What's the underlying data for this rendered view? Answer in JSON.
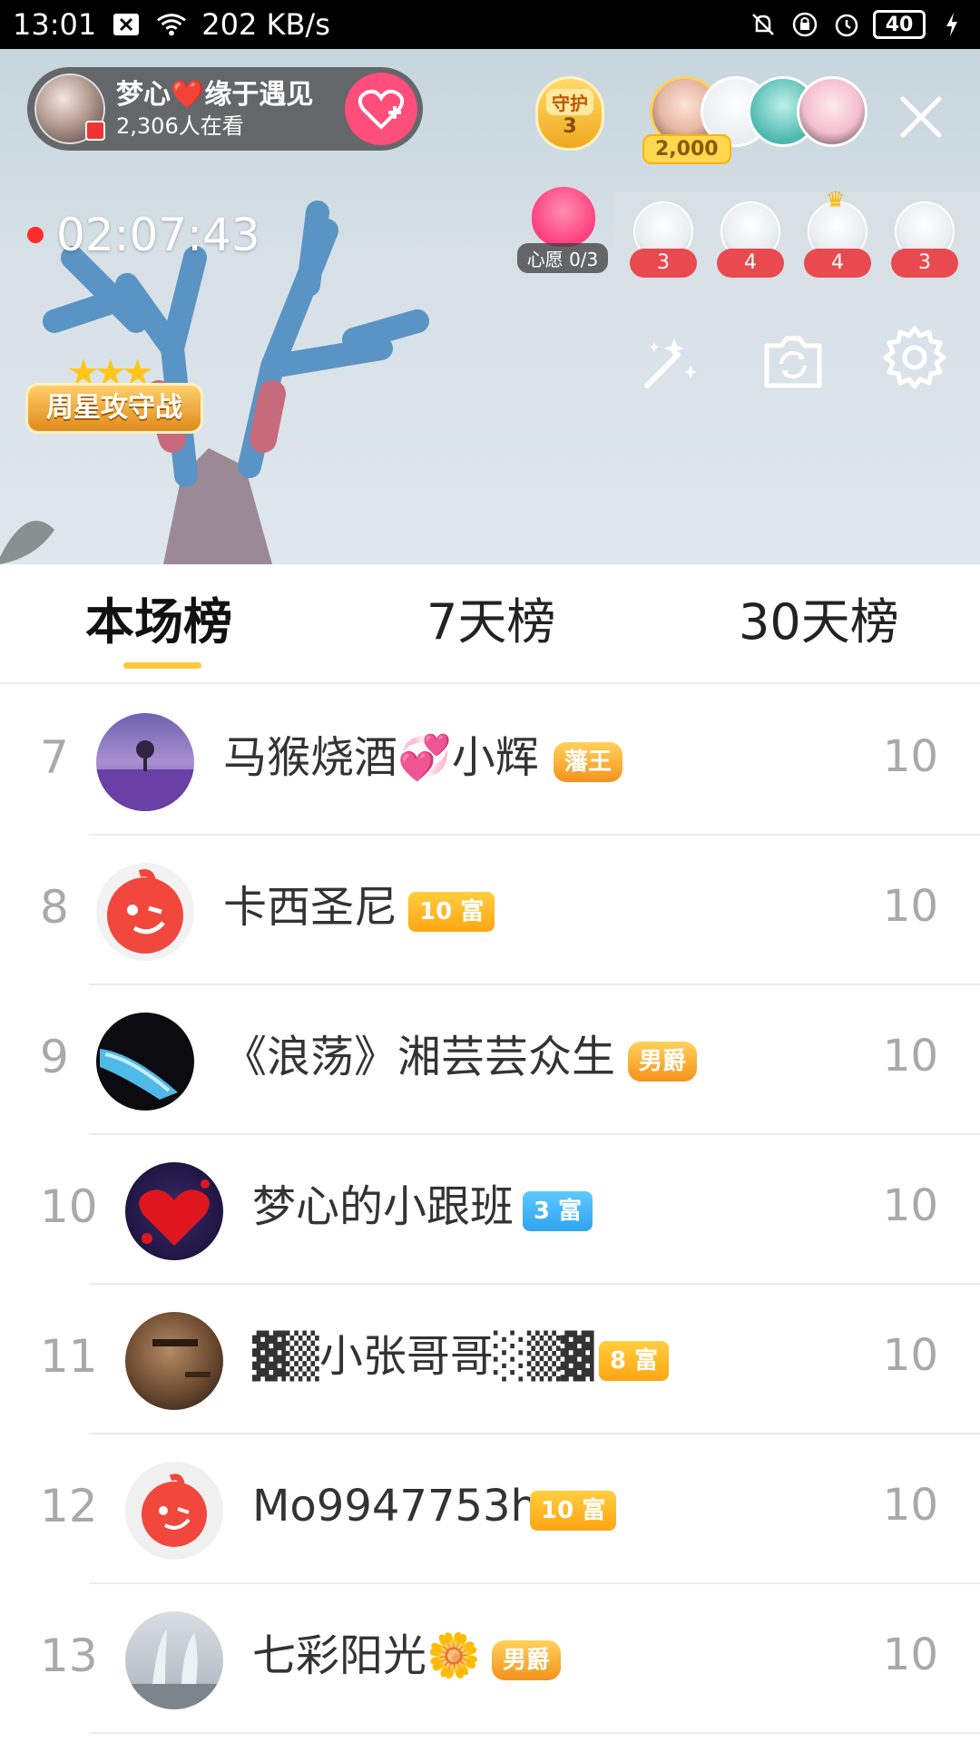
{
  "status_bar": {
    "time": "13:01",
    "network_speed": "202 KB/s",
    "battery": "40"
  },
  "live": {
    "host_name": "梦心❤️缘于遇见",
    "viewers": "2,306人在看",
    "guard_label": "守护",
    "guard_count": "3",
    "top_contribution": "2,000",
    "timer": "02:07:43",
    "wish_label": "心愿 0/3",
    "fans": [
      {
        "count": "3"
      },
      {
        "count": "4"
      },
      {
        "count": "4"
      },
      {
        "count": "3"
      }
    ],
    "battle_logo": "周星攻守战"
  },
  "tabs": [
    {
      "label": "本场榜",
      "active": true
    },
    {
      "label": "7天榜",
      "active": false
    },
    {
      "label": "30天榜",
      "active": false
    }
  ],
  "ranking": [
    {
      "rank": "7",
      "name": "马猴烧酒💞小辉",
      "badge": "藩王",
      "badge_type": "noble",
      "value": "10"
    },
    {
      "rank": "8",
      "name": "卡西圣尼",
      "badge": "10 富",
      "badge_type": "rich-orange",
      "value": "10"
    },
    {
      "rank": "9",
      "name": "《浪荡》湘芸芸众生",
      "badge": "男爵",
      "badge_type": "noble",
      "value": "10"
    },
    {
      "rank": "10",
      "name": "梦心的小跟班",
      "badge": "3 富",
      "badge_type": "rich-blue",
      "value": "10"
    },
    {
      "rank": "11",
      "name": "▓▒小张哥哥░▒▓",
      "badge": "8 富",
      "badge_type": "rich-orange",
      "value": "10"
    },
    {
      "rank": "12",
      "name": "Mo9947753h",
      "badge": "10 富",
      "badge_type": "rich-orange",
      "value": "10"
    },
    {
      "rank": "13",
      "name": "七彩阳光🌼",
      "badge": "男爵",
      "badge_type": "noble",
      "value": "10"
    }
  ]
}
